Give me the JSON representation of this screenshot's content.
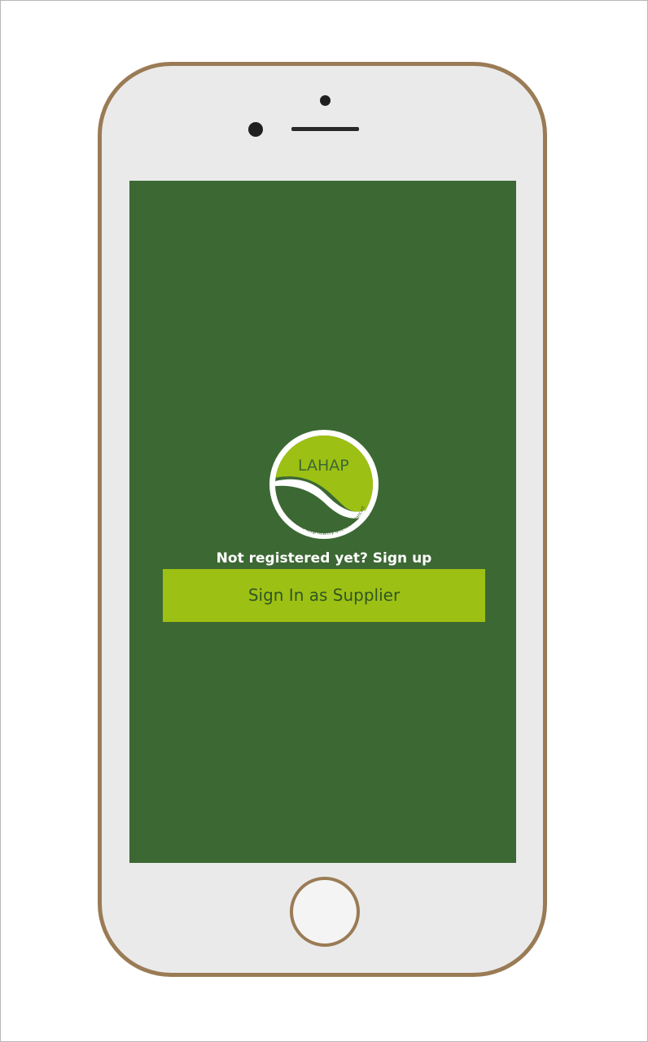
{
  "logo": {
    "brand": "LAHAP",
    "tagline": "with ours, we keep healthy and live balanced",
    "colors": {
      "lime": "#9dc014",
      "dark_green": "#3c6833",
      "white": "#ffffff"
    }
  },
  "auth": {
    "signup_prompt": "Not registered yet? Sign up",
    "signin_supplier_label": "Sign In as Supplier"
  },
  "theme": {
    "screen_bg": "#3c6833",
    "button_bg": "#9dc014",
    "button_text": "#2f5624",
    "phone_border": "#9a7b55"
  }
}
